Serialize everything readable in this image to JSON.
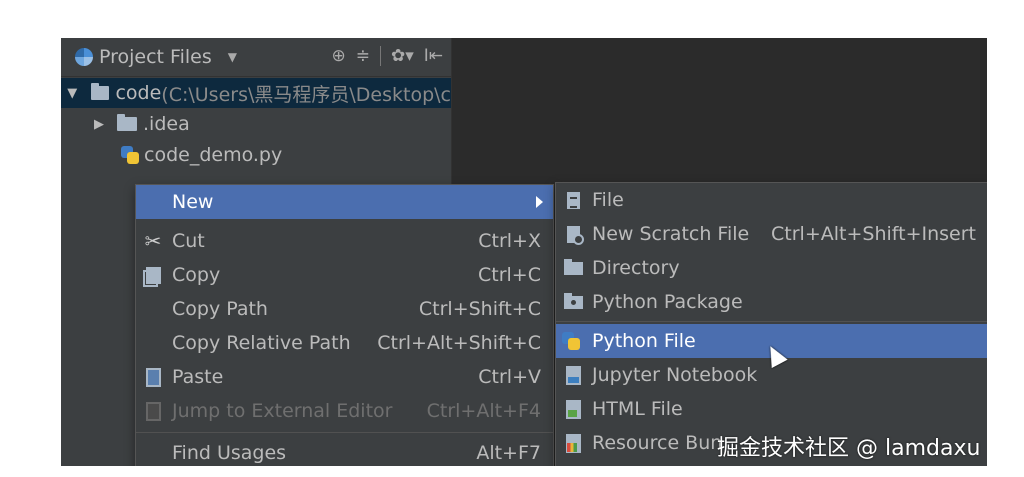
{
  "panel": {
    "title": "Project Files",
    "tools": [
      "⊕",
      "≑",
      "✿▾",
      "I⇤"
    ]
  },
  "tree": {
    "root_name": "code",
    "root_path": " (C:\\Users\\黑马程序员\\Desktop\\c",
    "idea": ".idea",
    "file": "code_demo.py"
  },
  "context_menu": {
    "new": "New",
    "cut": "Cut",
    "cut_shortcut": "Ctrl+X",
    "copy": "Copy",
    "copy_shortcut": "Ctrl+C",
    "copy_path": "Copy Path",
    "copy_path_shortcut": "Ctrl+Shift+C",
    "copy_relative_path": "Copy Relative Path",
    "copy_relative_path_shortcut": "Ctrl+Alt+Shift+C",
    "paste": "Paste",
    "paste_shortcut": "Ctrl+V",
    "jump_external": "Jump to External Editor",
    "jump_external_shortcut": "Ctrl+Alt+F4",
    "find_usages": "Find Usages",
    "find_usages_shortcut": "Alt+F7"
  },
  "new_submenu": {
    "file": "File",
    "new_scratch_file": "New Scratch File",
    "new_scratch_shortcut": "Ctrl+Alt+Shift+Insert",
    "directory": "Directory",
    "python_package": "Python Package",
    "python_file": "Python File",
    "jupyter_notebook": "Jupyter Notebook",
    "html_file": "HTML File",
    "resource_bundle": "Resource Bun"
  },
  "watermark": "掘金技术社区 @ lamdaxu",
  "colors": {
    "selection": "#4b6eaf",
    "panel_bg": "#3c3f41",
    "editor_bg": "#2b2b2b"
  }
}
